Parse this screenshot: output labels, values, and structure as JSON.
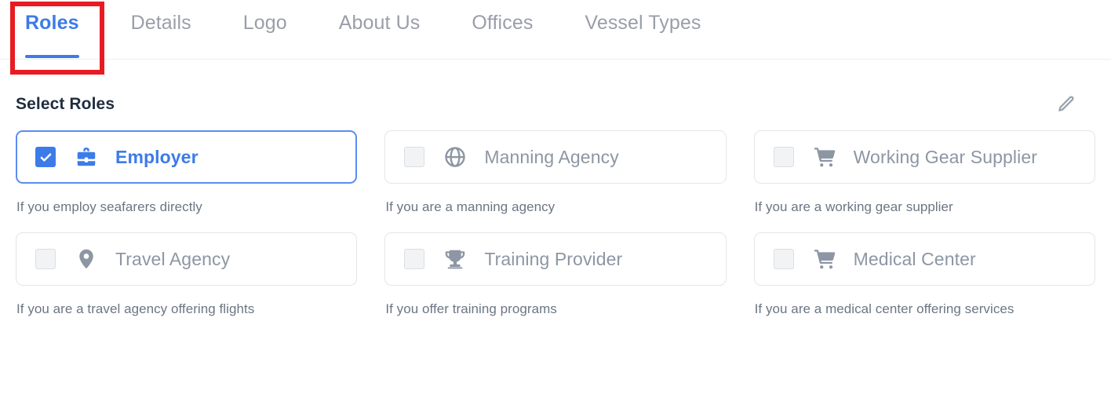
{
  "colors": {
    "accent": "#3d7be8",
    "selected_border": "#5b8def",
    "inactive_text": "#9a9ea8",
    "desc_text": "#6b7684",
    "title_text": "#1f2d3d",
    "annotation": "#e81b23",
    "card_border": "#e3e5e9",
    "checkbox_fill": "#f2f3f5"
  },
  "tabs": [
    {
      "label": "Roles",
      "active": true
    },
    {
      "label": "Details",
      "active": false
    },
    {
      "label": "Logo",
      "active": false
    },
    {
      "label": "About Us",
      "active": false
    },
    {
      "label": "Offices",
      "active": false
    },
    {
      "label": "Vessel Types",
      "active": false
    }
  ],
  "section": {
    "title": "Select Roles",
    "edit_icon": "pencil-icon"
  },
  "roles": [
    {
      "label": "Employer",
      "description": "If you employ seafarers directly",
      "icon": "briefcase-icon",
      "checked": true
    },
    {
      "label": "Manning Agency",
      "description": "If you are a manning agency",
      "icon": "globe-icon",
      "checked": false
    },
    {
      "label": "Working Gear Supplier",
      "description": "If you are a working gear supplier",
      "icon": "shopping-cart-icon",
      "checked": false
    },
    {
      "label": "Travel Agency",
      "description": "If you are a travel agency offering flights",
      "icon": "location-pin-icon",
      "checked": false
    },
    {
      "label": "Training Provider",
      "description": "If you offer training programs",
      "icon": "trophy-icon",
      "checked": false
    },
    {
      "label": "Medical Center",
      "description": "If you are a medical center offering services",
      "icon": "shopping-cart-icon",
      "checked": false
    }
  ]
}
